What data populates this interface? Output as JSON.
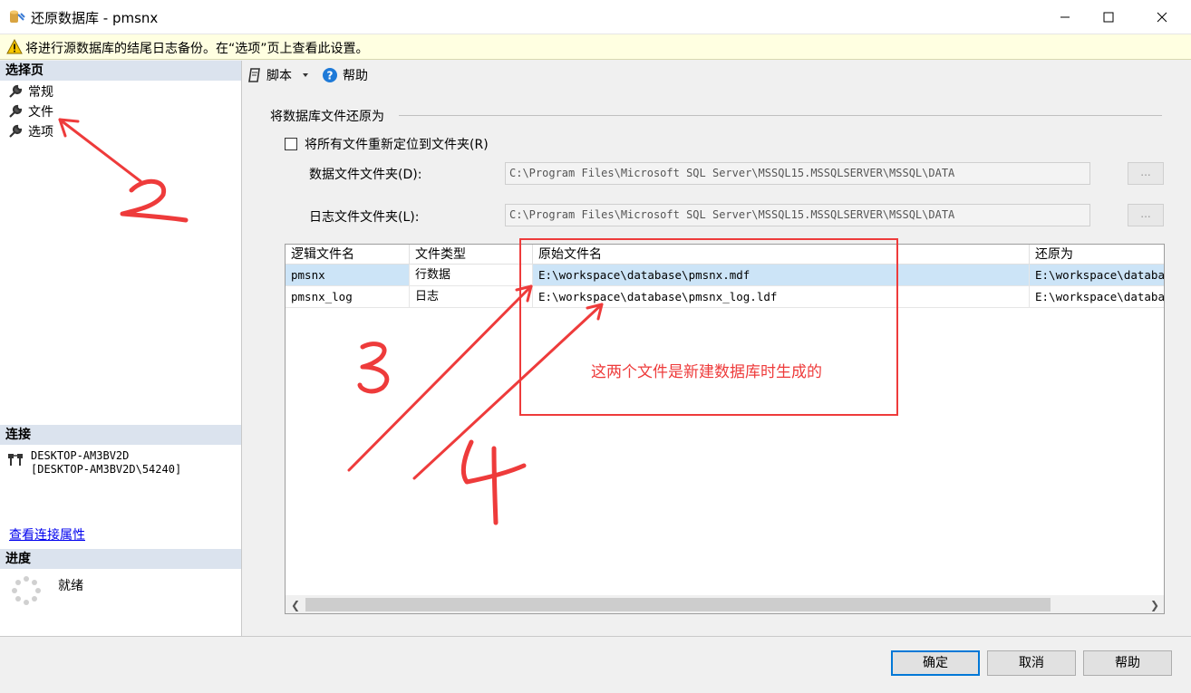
{
  "window": {
    "title": "还原数据库 - pmsnx",
    "minimize_label": "minimize",
    "maximize_label": "maximize",
    "close_label": "close"
  },
  "warning": {
    "text": "将进行源数据库的结尾日志备份。在“选项”页上查看此设置。"
  },
  "sidebar": {
    "select_page_header": "选择页",
    "pages": [
      {
        "label": "常规"
      },
      {
        "label": "文件"
      },
      {
        "label": "选项"
      }
    ],
    "connection_header": "连接",
    "connection_line1": "DESKTOP-AM3BV2D",
    "connection_line2": "[DESKTOP-AM3BV2D\\54240]",
    "connection_link": "查看连接属性",
    "progress_header": "进度",
    "progress_status": "就绪"
  },
  "toolbar": {
    "script_label": "脚本",
    "help_label": "帮助"
  },
  "restore_files": {
    "group_title": "将数据库文件还原为",
    "relocate_label": "将所有文件重新定位到文件夹(R)",
    "relocate_checked": false,
    "data_folder_label": "数据文件文件夹(D):",
    "data_folder_value": "C:\\Program Files\\Microsoft SQL Server\\MSSQL15.MSSQLSERVER\\MSSQL\\DATA",
    "log_folder_label": "日志文件文件夹(L):",
    "log_folder_value": "C:\\Program Files\\Microsoft SQL Server\\MSSQL15.MSSQLSERVER\\MSSQL\\DATA",
    "browse_label": "..."
  },
  "grid": {
    "columns": [
      "逻辑文件名",
      "文件类型",
      "原始文件名",
      "还原为"
    ],
    "rows": [
      {
        "logical": "pmsnx",
        "type": "行数据",
        "original": "E:\\workspace\\database\\pmsnx.mdf",
        "restore_as": "E:\\workspace\\database\\pmsnx.mdf"
      },
      {
        "logical": "pmsnx_log",
        "type": "日志",
        "original": "E:\\workspace\\database\\pmsnx_log.ldf",
        "restore_as": "E:\\workspace\\database\\pmsnx_log.ldf"
      }
    ]
  },
  "buttons": {
    "ok": "确定",
    "cancel": "取消",
    "help": "帮助"
  },
  "annotations": {
    "note": "这两个文件是新建数据库时生成的",
    "color": "#ee3b3b"
  }
}
